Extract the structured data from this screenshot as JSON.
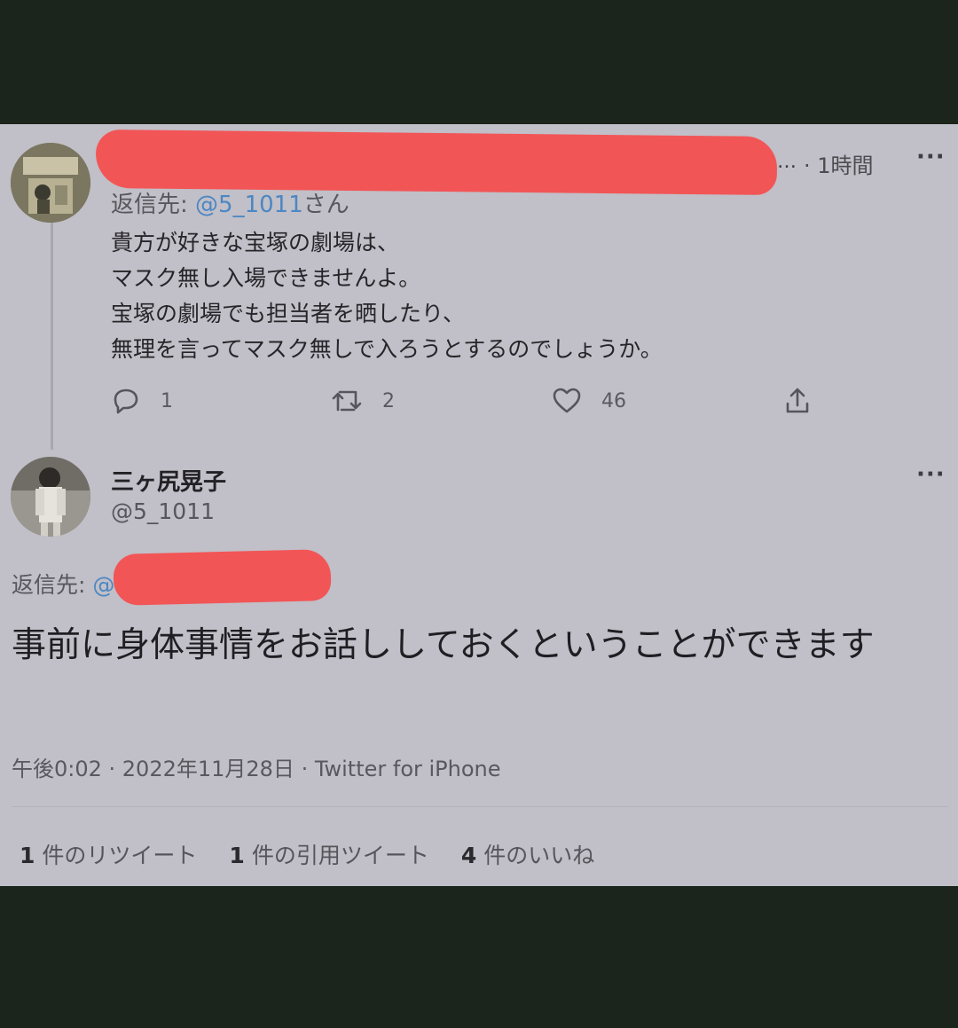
{
  "parent_tweet": {
    "time": "1時間",
    "reply_prefix": "返信先: ",
    "reply_handle": "@5_1011",
    "reply_suffix": "さん",
    "text_lines": [
      "貴方が好きな宝塚の劇場は、",
      "マスク無し入場できませんよ。",
      "宝塚の劇場でも担当者を晒したり、",
      "無理を言ってマスク無しで入ろうとするのでしょうか。"
    ],
    "reply_count": "1",
    "retweet_count": "2",
    "like_count": "46"
  },
  "main_tweet": {
    "display_name": "三ヶ尻晃子",
    "handle": "@5_1011",
    "reply_prefix": "返信先: ",
    "reply_handle": "@",
    "text": "事前に身体事情をお話ししておくということができます",
    "timestamp": "午後0:02 · 2022年11月28日 · Twitter for iPhone"
  },
  "stats": [
    {
      "count": "1",
      "label": "件のリツイート"
    },
    {
      "count": "1",
      "label": "件の引用ツイート"
    },
    {
      "count": "4",
      "label": "件のいいね"
    }
  ],
  "icons": {
    "more": "more-icon",
    "reply": "reply-icon",
    "retweet": "retweet-icon",
    "like": "heart-icon",
    "share": "share-icon"
  },
  "colors": {
    "card_background": "#c1bfc7",
    "frame_background": "#1b251b",
    "link": "#4c87c4",
    "redaction": "#f25556"
  }
}
